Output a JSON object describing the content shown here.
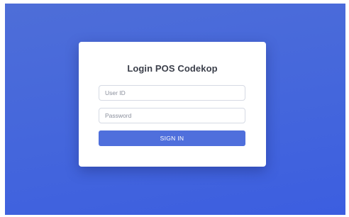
{
  "login": {
    "title": "Login POS Codekop",
    "user_id_placeholder": "User ID",
    "user_id_value": "",
    "password_placeholder": "Password",
    "password_value": "",
    "sign_in_label": "SIGN IN"
  },
  "colors": {
    "background": "#4466dc",
    "accent": "#4f6fdc",
    "card": "#ffffff"
  }
}
